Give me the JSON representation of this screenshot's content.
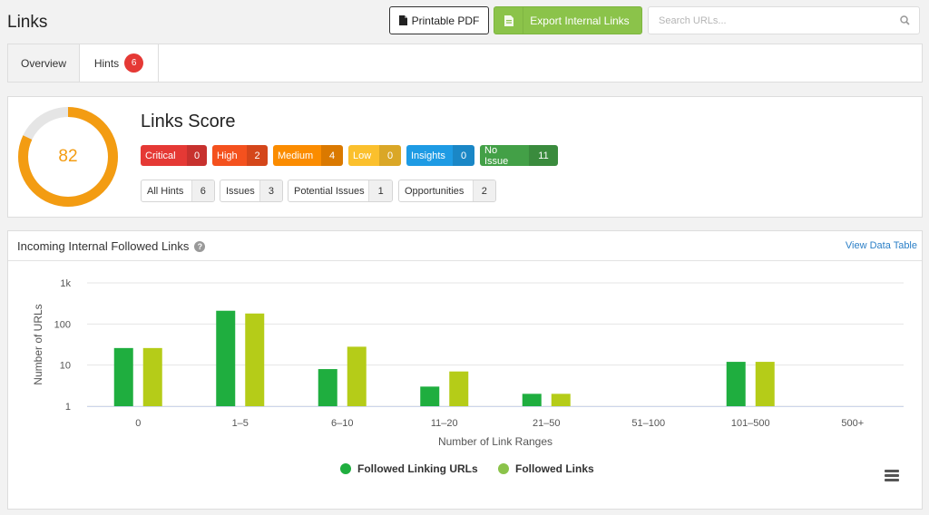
{
  "page": {
    "title": "Links"
  },
  "toolbar": {
    "pdf_label": "Printable PDF",
    "export_label": "Export Internal Links",
    "search_placeholder": "Search URLs..."
  },
  "tabs": [
    {
      "label": "Overview",
      "active": true
    },
    {
      "label": "Hints",
      "badge": "6"
    }
  ],
  "score": {
    "title": "Links Score",
    "value": "82",
    "fraction": 0.82,
    "severities": [
      {
        "label": "Critical",
        "count": "0",
        "color": "#e53935"
      },
      {
        "label": "High",
        "count": "2",
        "color": "#f4511e"
      },
      {
        "label": "Medium",
        "count": "4",
        "color": "#fb8c00"
      },
      {
        "label": "Low",
        "count": "0",
        "color": "#fbc02d"
      },
      {
        "label": "Insights",
        "count": "0",
        "color": "#1e9be4"
      },
      {
        "label": "No Issue",
        "count": "11",
        "color": "#43a047"
      }
    ],
    "hint_types": [
      {
        "label": "All Hints",
        "count": "6"
      },
      {
        "label": "Issues",
        "count": "3"
      },
      {
        "label": "Potential Issues",
        "count": "1"
      },
      {
        "label": "Opportunities",
        "count": "2"
      }
    ]
  },
  "chart_section": {
    "title": "Incoming Internal Followed Links",
    "view_table_label": "View Data Table"
  },
  "chart_data": {
    "type": "bar",
    "xlabel": "Number of Link Ranges",
    "ylabel": "Number of URLs",
    "yscale": "log",
    "ylim": [
      1,
      1000
    ],
    "yticks": [
      {
        "value": 1,
        "label": "1"
      },
      {
        "value": 10,
        "label": "10"
      },
      {
        "value": 100,
        "label": "100"
      },
      {
        "value": 1000,
        "label": "1k"
      }
    ],
    "grid": true,
    "legend": "bottom-center",
    "categories": [
      "0",
      "1–5",
      "6–10",
      "11–20",
      "21–50",
      "51–100",
      "101–500",
      "500+"
    ],
    "series": [
      {
        "name": "Followed Linking URLs",
        "color": "#1fae3f",
        "values": [
          26,
          210,
          8,
          3,
          2,
          null,
          12,
          null
        ]
      },
      {
        "name": "Followed Links",
        "color": "#b5cc18",
        "values": [
          26,
          180,
          28,
          7,
          2,
          1,
          12,
          null
        ]
      }
    ]
  }
}
